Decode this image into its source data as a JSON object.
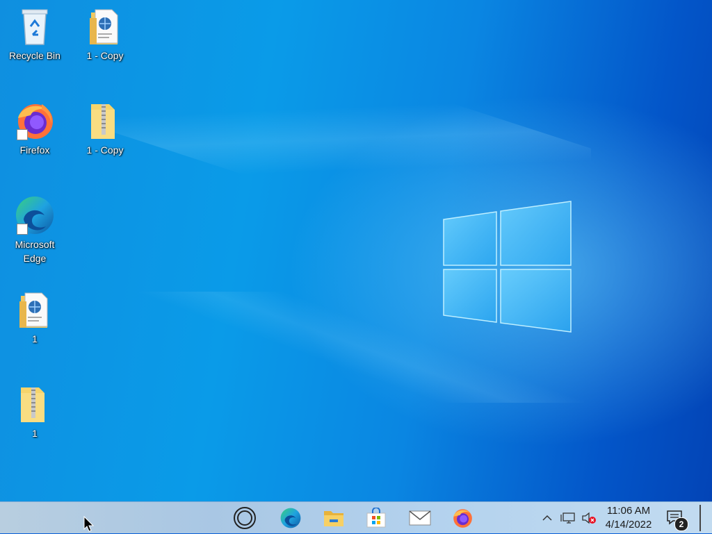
{
  "desktop": {
    "icons": [
      {
        "label": "Recycle Bin",
        "icon": "recycle-bin-icon"
      },
      {
        "label": "1 - Copy",
        "icon": "html-document-icon"
      },
      {
        "label": "Firefox",
        "icon": "firefox-icon"
      },
      {
        "label": "1 - Copy",
        "icon": "zip-folder-icon"
      },
      {
        "label": "Microsoft Edge",
        "icon": "edge-icon"
      },
      {
        "label": "1",
        "icon": "html-document-icon"
      },
      {
        "label": "1",
        "icon": "zip-folder-icon"
      }
    ]
  },
  "taskbar": {
    "apps": [
      {
        "name": "cortana",
        "icon": "cortana-icon"
      },
      {
        "name": "edge",
        "icon": "edge-icon"
      },
      {
        "name": "file-explorer",
        "icon": "folder-icon"
      },
      {
        "name": "store",
        "icon": "store-icon"
      },
      {
        "name": "mail",
        "icon": "mail-icon"
      },
      {
        "name": "firefox",
        "icon": "firefox-icon"
      }
    ],
    "tray": {
      "time": "11:06 AM",
      "date": "4/14/2022",
      "notification_count": "2"
    }
  },
  "colors": {
    "wallpaper_blue": "#0a86e2",
    "taskbar_bg": "#b3d2ee"
  }
}
